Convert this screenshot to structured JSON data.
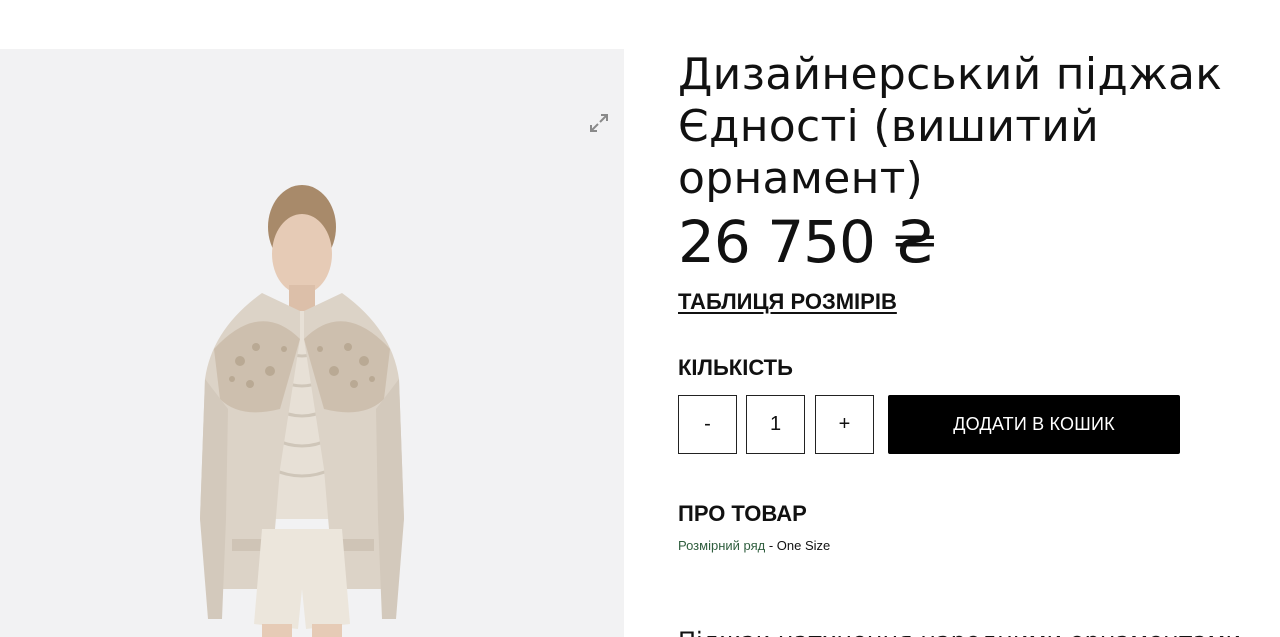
{
  "product": {
    "title": "Дизайнерський піджак Єдності (вишитий орнамент)",
    "price": "26 750 ₴",
    "size_table_link": "ТАБЛИЦЯ РОЗМІРІВ",
    "quantity_label": "КІЛЬКІСТЬ",
    "quantity_minus": "-",
    "quantity_value": "1",
    "quantity_plus": "+",
    "add_to_cart": "ДОДАТИ В КОШИК",
    "about_heading": "ПРО ТОВАР",
    "size_range_key": "Розмірний ряд",
    "size_range_sep": " - ",
    "size_range_value": "One Size",
    "description_partial": "Піджак натхнення народними орнаментами"
  },
  "gallery": {
    "expand_icon": "expand-arrows-icon"
  },
  "colors": {
    "gallery_bg": "#f2f2f3",
    "button_bg": "#000000",
    "size_key_color": "#2f5e3e"
  }
}
